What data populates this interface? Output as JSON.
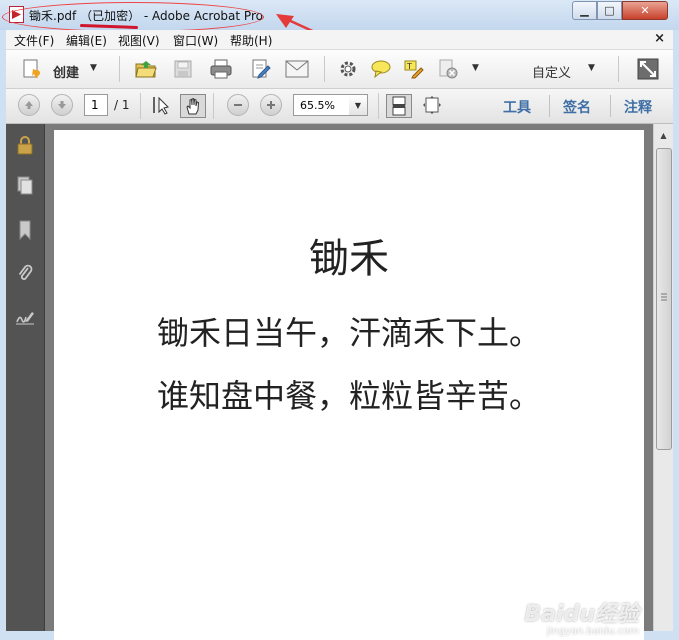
{
  "window": {
    "title": "锄禾.pdf （已加密） - Adobe Acrobat Pro",
    "minimize": "▁",
    "maximize": "□",
    "close": "✕"
  },
  "menu": [
    {
      "label": "文件(F)"
    },
    {
      "label": "编辑(E)"
    },
    {
      "label": "视图(V)"
    },
    {
      "label": "窗口(W)"
    },
    {
      "label": "帮助(H)"
    }
  ],
  "menu_close": "×",
  "toolbar1": {
    "create_label": "创建",
    "custom_label": "自定义",
    "dropdown_glyph": "▼"
  },
  "toolbar2": {
    "current_page": "1",
    "total_pages": "/ 1",
    "zoom": "65.5%",
    "zoom_drop": "▼",
    "tools_label": "工具",
    "sign_label": "签名",
    "comment_label": "注释"
  },
  "document": {
    "title": "锄禾",
    "lines": [
      "锄禾日当午，汗滴禾下土。",
      "谁知盘中餐，粒粒皆辛苦。"
    ]
  },
  "scrollbar": {
    "up": "▲"
  },
  "watermark": {
    "main": "Baidu经验",
    "sub": "jingyan.baidu.com"
  },
  "colors": {
    "annotation_red": "#e43a3a",
    "pane_link_blue": "#3f6fa5",
    "nav_panel": "#535353",
    "doc_background": "#7b7b7b"
  }
}
